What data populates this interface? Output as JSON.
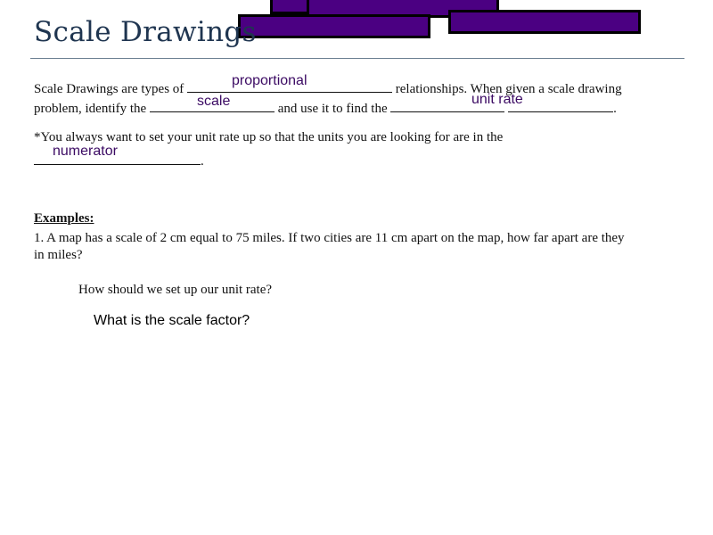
{
  "header": {
    "title": "Scale Drawings",
    "accent_color": "#4b0082"
  },
  "intro": {
    "line1_pre": "Scale Drawings are types of ",
    "line1_post": " relationships.   When given a scale drawing",
    "line2_pre": "problem, identify the ",
    "line2_mid": " and use it to find the ",
    "line2_post": ".",
    "answers": {
      "proportional": "proportional",
      "scale": "scale",
      "unit_rate": "unit rate"
    }
  },
  "note": {
    "line1": "*You always want to set your unit rate up so that the units you are looking for are in the",
    "line2_post": ".",
    "answer": "numerator"
  },
  "examples": {
    "heading": "Examples:",
    "problem1_line1": "1.  A map has a scale of 2 cm equal to 75 miles.   If two cities are 11 cm apart on the map, how far apart are they",
    "problem1_line2": "in miles?",
    "question1": "How should we set up our unit rate?",
    "question2": "What is the scale factor?"
  }
}
